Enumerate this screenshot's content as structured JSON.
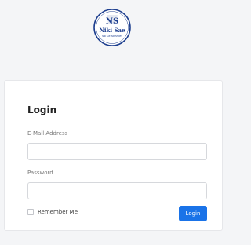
{
  "logo": {
    "monogram": "NS",
    "name": "Niki Sae",
    "tagline": "NIKI SAE INDUSTRIES"
  },
  "login": {
    "title": "Login",
    "email_label": "E-Mail Address",
    "email_value": "",
    "password_label": "Password",
    "password_value": "",
    "remember_label": "Remember Me",
    "remember_checked": false,
    "submit_label": "Login"
  },
  "colors": {
    "page_background": "#f4f5f7",
    "card_background": "#ffffff",
    "primary": "#1a73e8",
    "logo_blue": "#1e3f8f"
  },
  "icons": {
    "logo": "niki-sae-logo-icon",
    "checkbox": "checkbox-icon"
  }
}
